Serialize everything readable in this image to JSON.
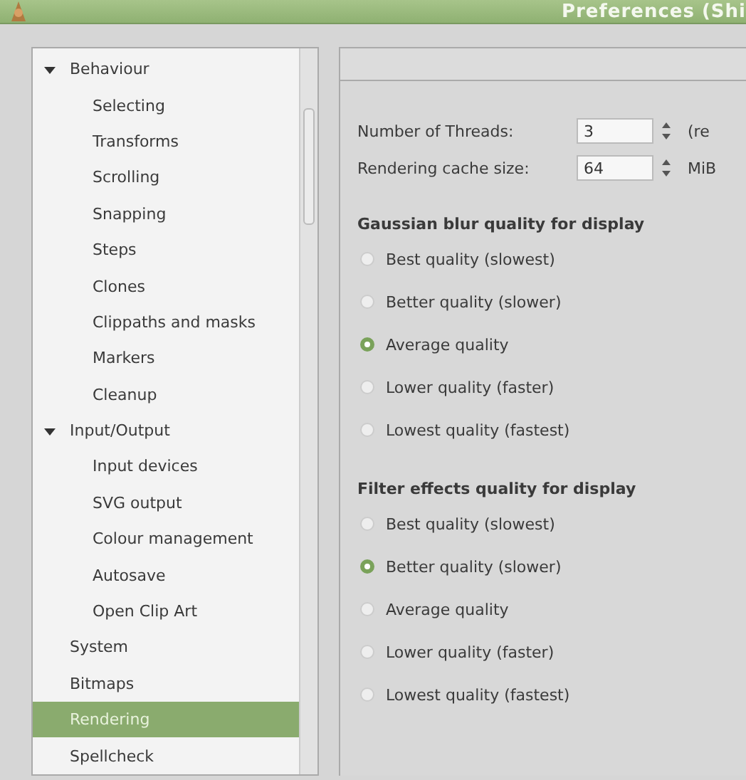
{
  "window": {
    "title": "Preferences (Shi"
  },
  "sidebar": {
    "items": [
      {
        "label": "Behaviour",
        "expanded": true,
        "selected": false,
        "children": [
          {
            "label": "Selecting",
            "selected": false
          },
          {
            "label": "Transforms",
            "selected": false
          },
          {
            "label": "Scrolling",
            "selected": false
          },
          {
            "label": "Snapping",
            "selected": false
          },
          {
            "label": "Steps",
            "selected": false
          },
          {
            "label": "Clones",
            "selected": false
          },
          {
            "label": "Clippaths and masks",
            "selected": false
          },
          {
            "label": "Markers",
            "selected": false
          },
          {
            "label": "Cleanup",
            "selected": false
          }
        ]
      },
      {
        "label": "Input/Output",
        "expanded": true,
        "selected": false,
        "children": [
          {
            "label": "Input devices",
            "selected": false
          },
          {
            "label": "SVG output",
            "selected": false
          },
          {
            "label": "Colour management",
            "selected": false
          },
          {
            "label": "Autosave",
            "selected": false
          },
          {
            "label": "Open Clip Art",
            "selected": false
          }
        ]
      },
      {
        "label": "System",
        "selected": false
      },
      {
        "label": "Bitmaps",
        "selected": false
      },
      {
        "label": "Rendering",
        "selected": true
      },
      {
        "label": "Spellcheck",
        "selected": false
      }
    ]
  },
  "settings": {
    "spinners": [
      {
        "label": "Number of Threads:",
        "value": "3",
        "suffix": "(re"
      },
      {
        "label": "Rendering cache size:",
        "value": "64",
        "suffix": "MiB"
      }
    ],
    "groups": [
      {
        "heading": "Gaussian blur quality for display",
        "options": [
          {
            "label": "Best quality (slowest)",
            "selected": false
          },
          {
            "label": "Better quality (slower)",
            "selected": false
          },
          {
            "label": "Average quality",
            "selected": true
          },
          {
            "label": "Lower quality (faster)",
            "selected": false
          },
          {
            "label": "Lowest quality (fastest)",
            "selected": false
          }
        ]
      },
      {
        "heading": "Filter effects quality for display",
        "options": [
          {
            "label": "Best quality (slowest)",
            "selected": false
          },
          {
            "label": "Better quality (slower)",
            "selected": true
          },
          {
            "label": "Average quality",
            "selected": false
          },
          {
            "label": "Lower quality (faster)",
            "selected": false
          },
          {
            "label": "Lowest quality (fastest)",
            "selected": false
          }
        ]
      }
    ]
  }
}
